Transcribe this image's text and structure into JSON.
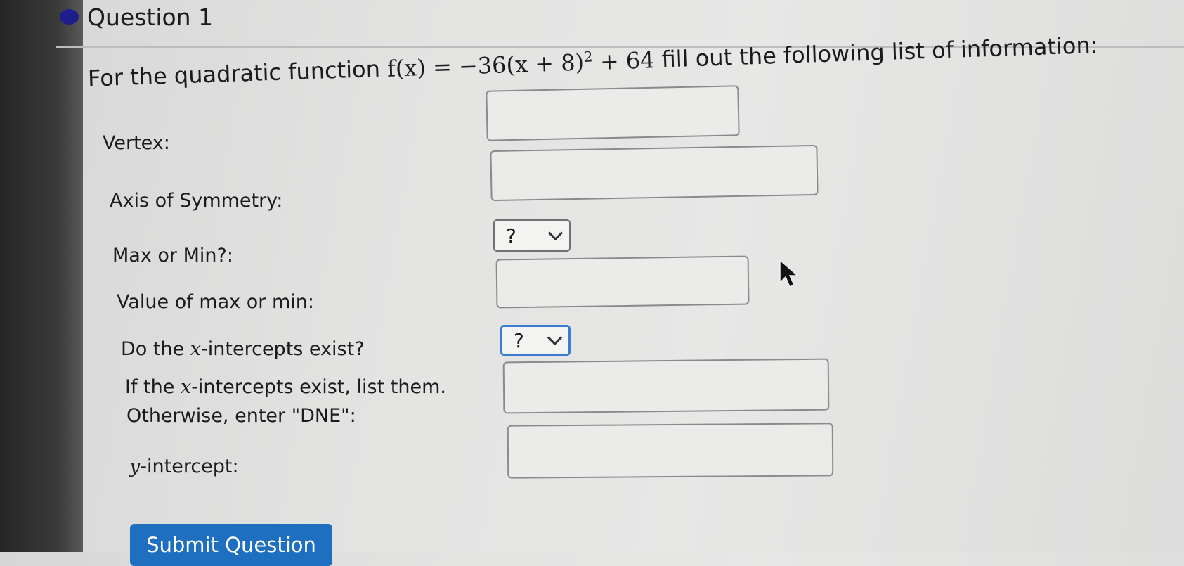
{
  "question": {
    "title": "Question 1",
    "prompt_lead": "For the quadratic function ",
    "prompt_math": "f(x) = −36(x + 8)",
    "prompt_exp": "2",
    "prompt_math_tail": " + 64",
    "prompt_trail": " fill out the following list of information:"
  },
  "fields": {
    "vertex_label": "Vertex:",
    "axis_label": "Axis of Symmetry:",
    "maxmin_label": "Max or Min?:",
    "maxmin_selected": "?",
    "value_label": "Value of max or min:",
    "xint_exist_label_pre": "Do the ",
    "xint_exist_var": "x",
    "xint_exist_label_post": "-intercepts exist?",
    "xint_exist_selected": "?",
    "xint_list_label1_pre": "If the ",
    "xint_list_var": "x",
    "xint_list_label1_post": "-intercepts exist, list them.",
    "xint_list_label2": "Otherwise, enter \"DNE\":",
    "yint_var": "y",
    "yint_label_post": "-intercept:"
  },
  "submit_label": "Submit Question",
  "colors": {
    "accent": "#1f6fc0",
    "status_dot": "#1d1e8a",
    "focus": "#3c7bd0"
  }
}
